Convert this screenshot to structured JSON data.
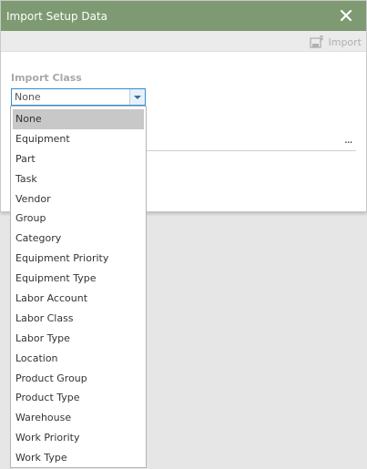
{
  "dialog": {
    "title": "Import Setup Data",
    "toolbar": {
      "import_label": "Import"
    }
  },
  "import_class": {
    "label": "Import Class",
    "value": "None",
    "options": [
      "None",
      "Equipment",
      "Part",
      "Task",
      "Vendor",
      "Group",
      "Category",
      "Equipment Priority",
      "Equipment Type",
      "Labor Account",
      "Labor Class",
      "Labor Type",
      "Location",
      "Product Group",
      "Product Type",
      "Warehouse",
      "Work Priority",
      "Work Type"
    ],
    "selected_index": 0
  },
  "file_browse": {
    "label": "..."
  },
  "colors": {
    "titlebar": "#7d9a72",
    "accent": "#2f8fd2",
    "selected_item": "#c8c8c8",
    "background": "#e6e6e6"
  },
  "icons": {
    "close": "close-icon",
    "import": "import-icon",
    "dropdown": "chevron-down-icon"
  }
}
